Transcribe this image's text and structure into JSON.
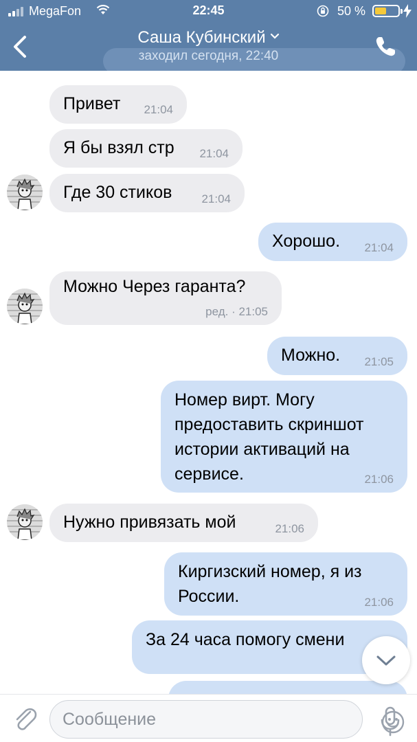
{
  "status_bar": {
    "carrier": "MegaFon",
    "time": "22:45",
    "battery": "50 %",
    "battery_level": 0.5
  },
  "header": {
    "contact_name": "Саша Кубинский",
    "last_seen": "заходил сегодня, 22:40",
    "icons": [
      "back-chevron-icon",
      "chevron-down-icon",
      "phone-icon"
    ]
  },
  "messages": [
    {
      "dir": "in",
      "text": "Привет",
      "time": "21:04",
      "avatar": false
    },
    {
      "dir": "in",
      "text": "Я бы взял стр",
      "time": "21:04",
      "avatar": false
    },
    {
      "dir": "in",
      "text": "Где 30 стиков",
      "time": "21:04",
      "avatar": true
    },
    {
      "dir": "out",
      "text": "Хорошо.",
      "time": "21:04"
    },
    {
      "dir": "in",
      "text": "Можно Через гаранта?",
      "time": "ред. · 21:05",
      "avatar": true
    },
    {
      "dir": "out",
      "text": "Можно.",
      "time": "21:05"
    },
    {
      "dir": "out",
      "lines": [
        "Номер вирт. Могу",
        "предоставить скриншот",
        "истории активаций на",
        "сервисе."
      ],
      "time": "21:06"
    },
    {
      "dir": "in",
      "text": "Нужно привязать мой",
      "time": "21:06",
      "avatar": true
    },
    {
      "dir": "out",
      "lines": [
        "Киргизский номер, я из",
        "России."
      ],
      "time": "21:06"
    },
    {
      "dir": "out",
      "text": "За 24 часа помогу смени",
      "time": ""
    }
  ],
  "composer": {
    "placeholder": "Сообщение",
    "icons": [
      "paperclip-icon",
      "emoji-icon",
      "microphone-icon",
      "chevron-down-icon"
    ]
  },
  "colors": {
    "header_bg": "#5b7fa8",
    "incoming_bubble": "#ececef",
    "outgoing_bubble": "#cfe0f6",
    "time_text": "#8e95a0"
  }
}
